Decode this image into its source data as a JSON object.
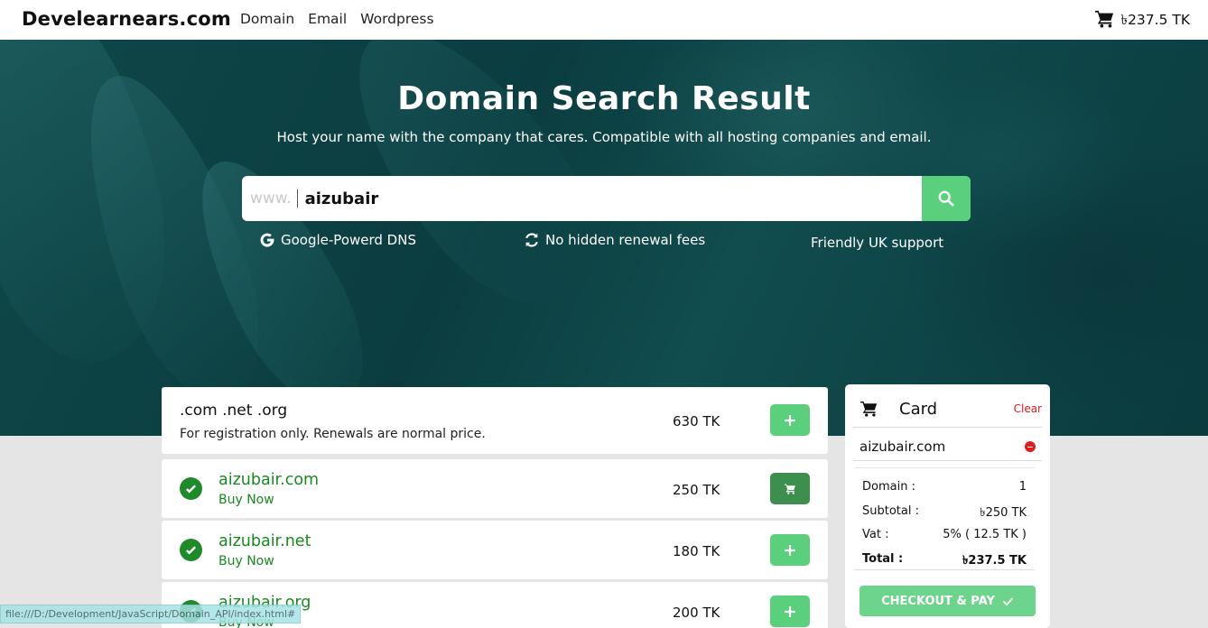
{
  "navbar": {
    "brand": "Develearnears.com",
    "links": [
      "Domain",
      "Email",
      "Wordpress"
    ],
    "cart_total": "৳237.5 TK"
  },
  "hero": {
    "title": "Domain Search Result",
    "subtitle": "Host your name with the company that cares. Compatible with all hosting companies and email.",
    "search_prefix": "www.",
    "search_value": "aizubair",
    "features": [
      "Google-Powerd DNS",
      "No hidden renewal fees",
      "Friendly UK support"
    ]
  },
  "results": {
    "header": {
      "title": ".com .net .org",
      "description": "For registration only. Renewals are normal price.",
      "price": "630 TK"
    },
    "items": [
      {
        "domain": "aizubair.com",
        "action": "Buy Now",
        "price": "250 TK",
        "in_cart": true
      },
      {
        "domain": "aizubair.net",
        "action": "Buy Now",
        "price": "180 TK",
        "in_cart": false
      },
      {
        "domain": "aizubair.org",
        "action": "Buy Now",
        "price": "200 TK",
        "in_cart": false
      }
    ]
  },
  "card": {
    "title": "Card",
    "clear_label": "Clear",
    "items": [
      "aizubair.com"
    ],
    "summary": {
      "domain_label": "Domain :",
      "domain_value": "1",
      "subtotal_label": "Subtotal :",
      "subtotal_value": "৳250 TK",
      "vat_label": "Vat :",
      "vat_value": "5% ( 12.5 TK )",
      "total_label": "Total :",
      "total_value": "৳237.5 TK"
    },
    "checkout_label": "CHECKOUT & PAY"
  },
  "status_bar": "file:///D:/Development/JavaScript/Domain_API/index.html#",
  "colors": {
    "accent_green": "#5ad07d",
    "success_green": "#168a1e",
    "danger_red": "#e21b1b",
    "hero_teal": "#0f4748"
  },
  "icons": [
    "cart-icon",
    "search-icon",
    "google-icon",
    "refresh-icon",
    "check-circle-icon",
    "plus-icon",
    "remove-icon",
    "checkmark-icon"
  ]
}
